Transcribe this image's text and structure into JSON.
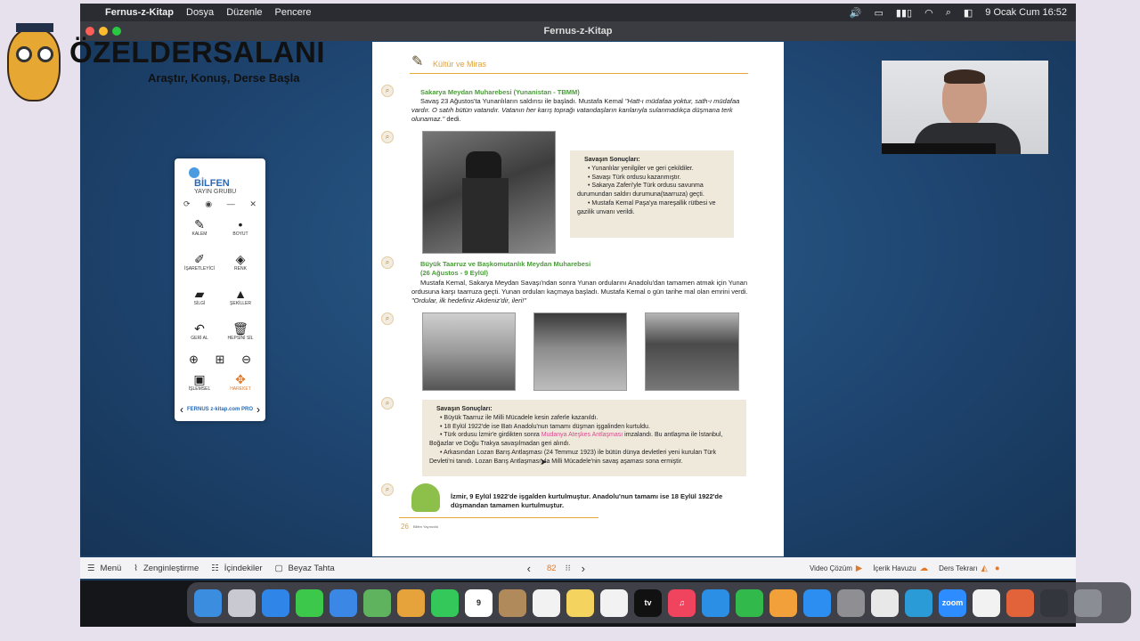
{
  "menubar": {
    "app": "Fernus-z-Kitap",
    "items": [
      "Dosya",
      "Düzenle",
      "Pencere"
    ],
    "clock": "9 Ocak Cum  16:52"
  },
  "window": {
    "title": "Fernus-z-Kitap"
  },
  "logo": {
    "brand": "ÖZELDERSALANI",
    "tagline": "Araştır, Konuş, Derse Başla"
  },
  "book": {
    "section_title": "Kültür ve Miras",
    "h1": "Sakarya Meydan Muharebesi (Yunanistan - TBMM)",
    "p1a": "Savaş 23 Ağustos'ta Yunanlıların saldırısı ile başladı. Mustafa Kemal ",
    "p1b": "\"Hatt-ı müdafaa yoktur, sath-ı müdafaa vardır. O satıh bütün vatandır. Vatanın her karış toprağı vatandaşların kanlarıyla sulanmadıkça düşmana terk olunamaz.\"",
    "p1c": " dedi.",
    "res1_title": "Savaşın Sonuçları:",
    "res1": [
      "• Yunanlılar yenilgiler ve geri çekildiler.",
      "• Savaşı Türk ordusu kazanmıştır.",
      "• Sakarya Zaferi'yle Türk ordusu savunma durumundan saldırı durumuna(taarruza) geçti.",
      "• Mustafa Kemal Paşa'ya mareşallik rütbesi ve gazilik unvanı verildi."
    ],
    "h2a": "Büyük Taarruz ve Başkomutanlık Meydan Muharebesi",
    "h2b": "(26 Ağustos - 9 Eylül)",
    "p2a": "Mustafa Kemal, Sakarya Meydan Savaşı'ndan sonra Yunan ordularını Anadolu'dan tamamen atmak için Yunan ordusuna karşı taarruza geçti. Yunan orduları kaçmaya başladı. Mustafa Kemal o gün tarihe mal olan emrini verdi. ",
    "p2b": "\"Ordular, ilk hedefiniz Akdeniz'dir, ileri!\"",
    "res2_title": "Savaşın Sonuçları:",
    "res2_1": "• Büyük Taarruz ile Milli Mücadele kesin zaferle kazanıldı.",
    "res2_2": "• 18 Eylül 1922'de ise Batı Anadolu'nun tamamı düşman işgalinden kurtuldu.",
    "res2_3a": "• Türk ordusu İzmir'e girdikten sonra ",
    "res2_3b": "Mudanya Ateşkes Antlaşması",
    "res2_3c": " imzalandı. Bu antlaşma ile İstanbul, Boğazlar ve Doğu Trakya savaşılmadan geri alındı.",
    "res2_4": "• Arkasından Lozan Barış Antlaşması (24 Temmuz 1923) ile bütün dünya devletleri yeni kurulan Türk Devleti'ni tanıdı. Lozan Barış Antlaşması'yla Milli Mücadele'nin savaş aşaması sona ermiştir.",
    "footer_note": "İzmir, 9 Eylül 1922'de işgalden kurtulmuştur. Anadolu'nun tamamı ise 18 Eylül 1922'de düşmandan tamamen kurtulmuştur.",
    "page_number": "26",
    "publisher": "Bilfen Yayıncılık"
  },
  "toolpanel": {
    "brand": "BİLFEN",
    "sub": "YAYIN GRUBU",
    "tools": [
      {
        "icon": "pen-icon",
        "glyph": "✎",
        "label": "KALEM"
      },
      {
        "icon": "size-icon",
        "glyph": "•",
        "label": "BOYUT"
      },
      {
        "icon": "marker-icon",
        "glyph": "✐",
        "label": "İŞARETLEYİCİ"
      },
      {
        "icon": "bucket-icon",
        "glyph": "◈",
        "label": "RENK"
      },
      {
        "icon": "eraser-icon",
        "glyph": "▰",
        "label": "SİLGİ"
      },
      {
        "icon": "shapes-icon",
        "glyph": "▲",
        "label": "ŞEKİLLER"
      },
      {
        "icon": "undo-icon",
        "glyph": "↶",
        "label": "GERİ AL"
      },
      {
        "icon": "trash-icon",
        "glyph": "🗑",
        "label": "HEPSİNİ SİL"
      }
    ],
    "bottom_tools": [
      {
        "icon": "window-icon",
        "glyph": "▣",
        "label": "İŞLEMSEL"
      },
      {
        "icon": "move-icon",
        "glyph": "✥",
        "label": "HAREKET"
      }
    ],
    "footer": "FERNUS z-kitap.com PRO"
  },
  "bottombar": {
    "menu": "Menü",
    "enrich": "Zenginleştirme",
    "contents": "İçindekiler",
    "whiteboard": "Beyaz Tahta",
    "page": "82",
    "video": "Video Çözüm",
    "content_pool": "İçerik Havuzu",
    "lesson_repeat": "Ders Tekrarı"
  },
  "dock": {
    "apps": [
      {
        "icon": "finder-icon",
        "label": "",
        "color": "#3b8de0"
      },
      {
        "icon": "launchpad-icon",
        "label": "",
        "color": "#c9c9d1"
      },
      {
        "icon": "safari-icon",
        "label": "",
        "color": "#2f86e8"
      },
      {
        "icon": "messages-icon",
        "label": "",
        "color": "#3cc84a"
      },
      {
        "icon": "mail-icon",
        "label": "",
        "color": "#3a87e6"
      },
      {
        "icon": "maps-icon",
        "label": "",
        "color": "#5fb35f"
      },
      {
        "icon": "photos-icon",
        "label": "",
        "color": "#e7a33b"
      },
      {
        "icon": "facetime-icon",
        "label": "",
        "color": "#34c759"
      },
      {
        "icon": "calendar-icon",
        "label": "9",
        "color": "#ffffff"
      },
      {
        "icon": "contacts-icon",
        "label": "",
        "color": "#b08a5a"
      },
      {
        "icon": "reminders-icon",
        "label": "",
        "color": "#f2f2f2"
      },
      {
        "icon": "notes-icon",
        "label": "",
        "color": "#f4d35e"
      },
      {
        "icon": "freeform-icon",
        "label": "",
        "color": "#f2f2f2"
      },
      {
        "icon": "tv-icon",
        "label": "tv",
        "color": "#111111"
      },
      {
        "icon": "music-icon",
        "label": "♫",
        "color": "#f0445e"
      },
      {
        "icon": "keynote-icon",
        "label": "",
        "color": "#2b8fe6"
      },
      {
        "icon": "numbers-icon",
        "label": "",
        "color": "#32b94b"
      },
      {
        "icon": "pages-icon",
        "label": "",
        "color": "#f2a03a"
      },
      {
        "icon": "appstore-icon",
        "label": "",
        "color": "#2c8ef0"
      },
      {
        "icon": "settings-icon",
        "label": "",
        "color": "#8e8e93"
      },
      {
        "icon": "chrome-icon",
        "label": "",
        "color": "#e8e8e8"
      },
      {
        "icon": "edge-icon",
        "label": "",
        "color": "#2a9bd6"
      },
      {
        "icon": "zoom-icon",
        "label": "zoom",
        "color": "#2d8cff"
      },
      {
        "icon": "bilfen-icon",
        "label": "",
        "color": "#f2f2f2"
      },
      {
        "icon": "book-icon",
        "label": "",
        "color": "#e2633a"
      },
      {
        "icon": "downloads-icon",
        "label": "",
        "color": "#33363d"
      },
      {
        "icon": "trash-icon",
        "label": "",
        "color": "#8a8d93"
      }
    ]
  }
}
